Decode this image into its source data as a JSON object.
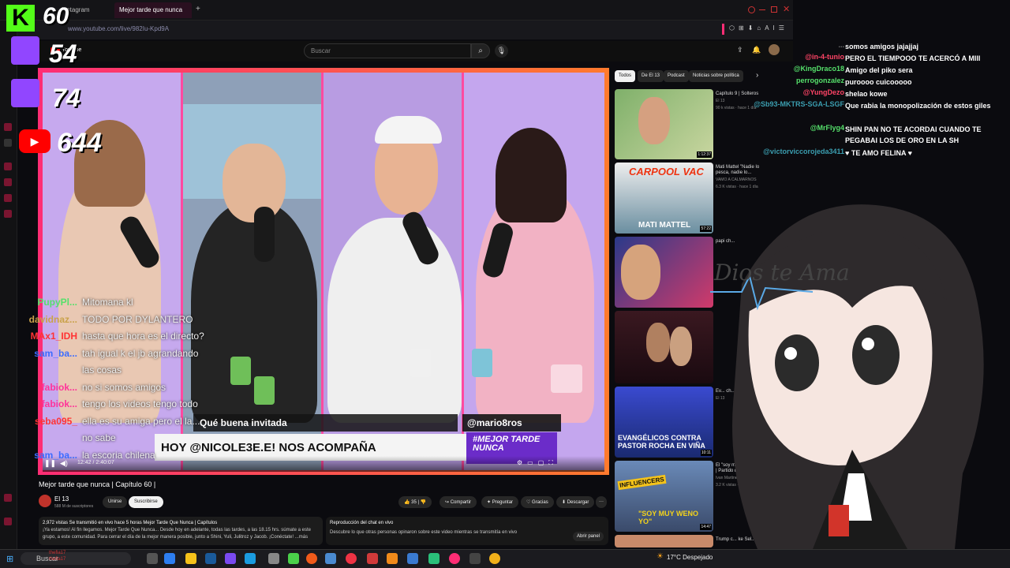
{
  "browser": {
    "tabs": [
      {
        "label": "Instagram"
      },
      {
        "label": "Mejor tarde que nunca"
      }
    ],
    "new_tab": "+",
    "url": "www.youtube.com/live/982Iu-Kpd9A"
  },
  "youtube": {
    "logo": "Youtube",
    "search_placeholder": "Buscar",
    "chips": [
      "Todos",
      "De El 13",
      "Podcast",
      "Noticias sobre política"
    ]
  },
  "video": {
    "caption_top": "Qué buena invitada",
    "handle": "@mario8ros",
    "caption_bottom": "HOY @NICOLE3E.E! NOS ACOMPAÑA",
    "brand": "#MEJOR TARDE NUNCA",
    "time": "12:42 / 2:40:07",
    "title": "Mejor tarde que nunca | Capítulo 60 |",
    "channel": "El 13",
    "subscribers": "588 M de suscriptores",
    "unirse": "Unirse",
    "subscribe": "Suscribirse",
    "likes": "35",
    "share": "Compartir",
    "ask": "Preguntar",
    "thanks": "Gracias",
    "download": "Descargar",
    "more": "···",
    "description_meta": "2,972 vistas  Se transmitió en vivo hace 5 horas  Mejor Tarde Que Nunca | Capítulos",
    "description_text": "¡Ya estamos! Al fin llegamos. Mejor Tarde Que Nunca... Desde hoy en adelante, todas las tardes, a las 18.15 hrs. súmate a este grupo, a este comunidad. Para cerrar el día de la mejor manera posible, junto a Shini, Yuli, Julitroz y Jacob. ¡Conéctate!  ...más",
    "replay_title": "Reproducción del chat en vivo",
    "replay_text": "Descubre lo que otras personas opinaron sobre este video mientras se transmitía en vivo",
    "replay_button": "Abrir panel"
  },
  "sidebar": {
    "items": [
      {
        "title": "Capítulo 9 | Solteros",
        "channel": "El 13",
        "meta": "90 k vistas · hace 1 día",
        "duration": "1:12:37"
      },
      {
        "title": "Mati Mattel \"Nadie lo pesca, nadie lo...",
        "channel": "VAMO A CALMARNOS",
        "meta": "6.3 K vistas · hace 1 día",
        "duration": "57:22",
        "thumb_text": "CARPOOL VAC",
        "thumb_sub": "MATI MATTEL"
      },
      {
        "title": "papi ch...",
        "channel": "",
        "meta": "",
        "duration": ""
      },
      {
        "title": "",
        "channel": "",
        "meta": "",
        "duration": ""
      },
      {
        "title": "Ev... ch...",
        "channel": "El 13",
        "meta": "",
        "duration": "10:11",
        "thumb_text": "EVANGÉLICOS CONTRA PASTOR ROCHA EN VIÑA"
      },
      {
        "title": "El \"soy muy we... real | Partido d...",
        "channel": "Ivan Martinez TV",
        "meta": "3.2 K vistas · hace 1 día",
        "duration": "14:47",
        "thumb_text": "\"SOY MUY WENO YO\"",
        "thumb_sub": "INFLUENCERS"
      },
      {
        "title": "Trump c... ke Sel...",
        "channel": "",
        "meta": "",
        "duration": ""
      }
    ]
  },
  "stream_overlay": {
    "kick_viewers": "60",
    "twitch1_viewers": "54",
    "twitch2_viewers": "74",
    "youtube_viewers": "644",
    "art_text": "Dios te Ama"
  },
  "right_chat": [
    {
      "user": "...",
      "msg": "somos amigos jajajjaj",
      "color": "#777777"
    },
    {
      "user": "@in-4-tunio",
      "msg": "PERO EL TIEMPOOO TE ACERCÓ A MIII",
      "color": "#ff4466"
    },
    {
      "user": "@KingDraco18",
      "msg": "Amigo del piko sera",
      "color": "#55e06b"
    },
    {
      "user": "perrogonzalez",
      "msg": "puroooo cuicooooo",
      "color": "#55e06b"
    },
    {
      "user": "@YungDezo",
      "msg": "shelao kowe",
      "color": "#ff4466"
    },
    {
      "user": "@Sb93-MKTRS-SGA-LSGF",
      "msg": "Que rabia la monopolización de estos giles",
      "color": "#3b9eb0"
    },
    {
      "user": "@MrFlyg4",
      "msg": "SHIN PAN NO TE ACORDAI CUANDO TE PEGABAI LOS DE ORO EN LA SH",
      "color": "#55e06b"
    },
    {
      "user": "@victorviccorojeda3411",
      "msg": "♥ TE AMO FELINA ♥",
      "color": "#3b9eb0"
    }
  ],
  "left_chat": [
    {
      "user": "PupyPl...",
      "msg": "Mitomana kl",
      "color": "#55e06b"
    },
    {
      "user": "davidnaz...",
      "msg": "TODO POR DYLANTERO",
      "color": "#c9a24a"
    },
    {
      "user": "MAx1_IDH",
      "msg": "hasta que hora es el directo?",
      "color": "#ff3333"
    },
    {
      "user": "sam_ba...",
      "msg": "tah igual k el jb agrandando",
      "color": "#3b6cff"
    },
    {
      "user": "",
      "msg": "las cosas",
      "color": "#ffffff"
    },
    {
      "user": "fabiok...",
      "msg": "no si somos amigos",
      "color": "#ff3399"
    },
    {
      "user": "fabiok...",
      "msg": "tengo los videos tengo todo",
      "color": "#ff3399"
    },
    {
      "user": "seba095_",
      "msg": "ella es su amiga pero el la...",
      "color": "#ff3333"
    },
    {
      "user": "",
      "msg": "no sabe",
      "color": "#ffffff"
    },
    {
      "user": "sam_ba...",
      "msg": "la escoria chilena",
      "color": "#3b6cff"
    }
  ],
  "taskbar": {
    "search": "Buscar",
    "weather": "17°C  Despejado",
    "chat_users": [
      "thefla17",
      "thefla17"
    ]
  },
  "colors": {
    "accent": "#ff2d75",
    "kick": "#53fc18",
    "twitch": "#9146ff",
    "youtube": "#ff0000"
  }
}
